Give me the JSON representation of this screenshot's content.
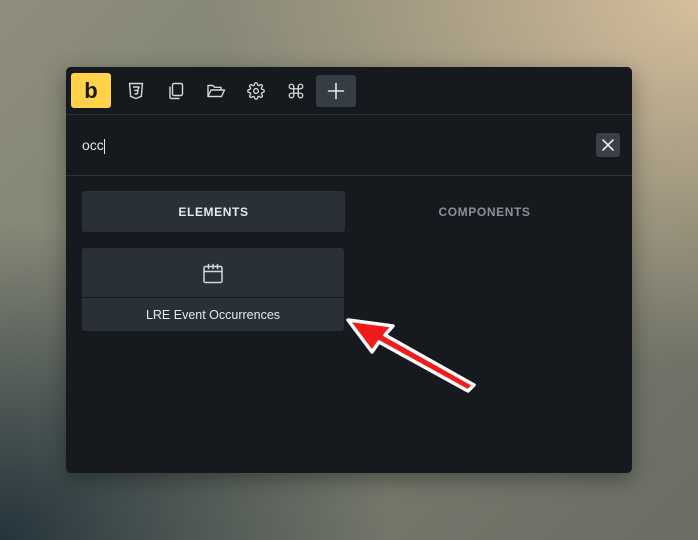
{
  "toolbar": {
    "logo_letter": "b",
    "buttons": [
      {
        "icon": "css3-icon"
      },
      {
        "icon": "pages-icon"
      },
      {
        "icon": "folder-open-icon"
      },
      {
        "icon": "settings-gear-icon"
      },
      {
        "icon": "command-icon"
      },
      {
        "icon": "plus-icon",
        "active": true
      }
    ]
  },
  "search": {
    "value": "occ"
  },
  "tabs": [
    {
      "label": "ELEMENTS",
      "active": true
    },
    {
      "label": "COMPONENTS",
      "active": false
    }
  ],
  "results": [
    {
      "label": "LRE Event Occurrences",
      "icon": "calendar-icon"
    }
  ],
  "colors": {
    "brand": "#ffd24a",
    "panel_bg": "#16191d",
    "surface": "#2a3038",
    "annotation_arrow": "#f21b1b"
  }
}
